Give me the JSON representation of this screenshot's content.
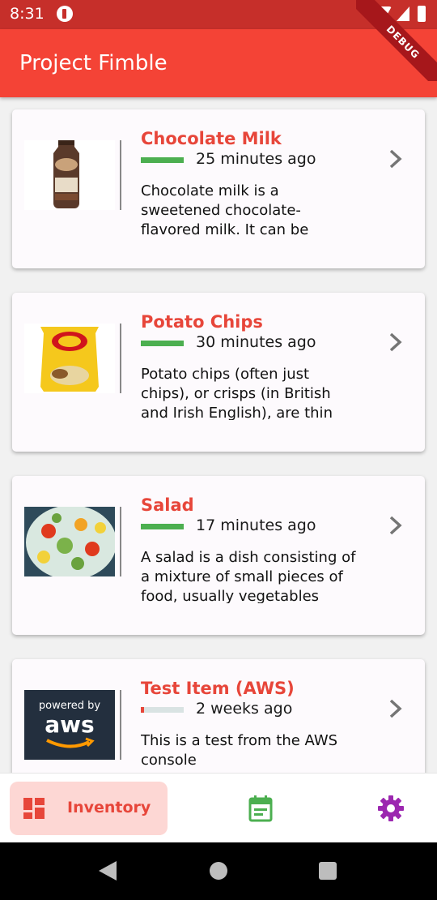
{
  "status_bar": {
    "time": "8:31"
  },
  "app": {
    "title": "Project Fimble",
    "debug_banner": "DEBUG"
  },
  "items": [
    {
      "name": "Chocolate Milk",
      "time": "25 minutes ago",
      "freshness": 1.0,
      "fresh_color": "#4caf50",
      "description": "Chocolate milk is a sweetened chocolate-flavored milk. It can be"
    },
    {
      "name": "Potato Chips",
      "time": "30 minutes ago",
      "freshness": 1.0,
      "fresh_color": "#4caf50",
      "description": "Potato chips (often just chips), or crisps (in British and Irish English), are thin"
    },
    {
      "name": "Salad",
      "time": "17 minutes ago",
      "freshness": 1.0,
      "fresh_color": "#4caf50",
      "description": "A salad is a dish consisting of a mixture of small pieces of food, usually vegetables"
    },
    {
      "name": "Test Item (AWS)",
      "time": "2 weeks ago",
      "freshness": 0.08,
      "fresh_color": "#e7463a",
      "description": "This is a test from the AWS console",
      "thumb_text_1": "powered by",
      "thumb_text_2": "aws"
    }
  ],
  "bottom_nav": {
    "inventory_label": "Inventory"
  },
  "colors": {
    "accent": "#f44336",
    "status_bar": "#c62f2a",
    "title_red": "#e7463a",
    "calendar_green": "#4caf50",
    "settings_purple": "#9c27b0"
  }
}
